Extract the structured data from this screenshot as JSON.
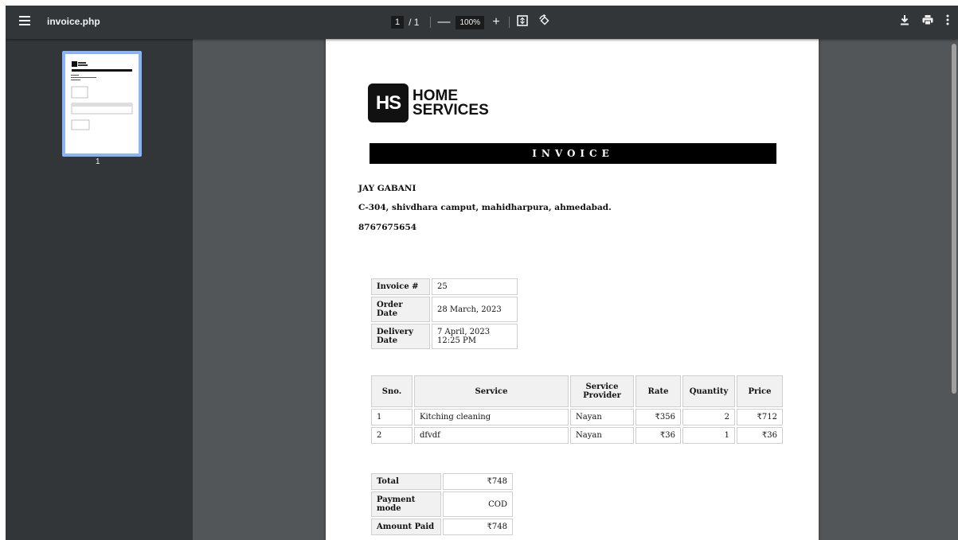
{
  "toolbar": {
    "title": "invoice.php",
    "page_current": "1",
    "page_total": "/ 1",
    "zoom": "100%",
    "zoom_out": "—",
    "zoom_in": "+"
  },
  "sidebar": {
    "thumb_label": "1"
  },
  "invoice": {
    "logo_mark": "HS",
    "logo_line1": "HOME",
    "logo_line2": "SERVICES",
    "heading": "INVOICE",
    "customer": {
      "name": "JAY GABANI",
      "address": "C-304, shivdhara camput, mahidharpura, ahmedabad.",
      "phone": "8767675654"
    },
    "meta": {
      "invoice_label": "Invoice #",
      "invoice_value": "25",
      "order_label": "Order Date",
      "order_value": "28 March, 2023",
      "delivery_label": "Delivery Date",
      "delivery_value": "7 April, 2023 12:25 PM"
    },
    "items_header": {
      "sno": "Sno.",
      "service": "Service",
      "provider": "Service Provider",
      "rate": "Rate",
      "quantity": "Quantity",
      "price": "Price"
    },
    "items": [
      {
        "sno": "1",
        "service": "Kitching cleaning",
        "provider": "Nayan",
        "rate": "₹356",
        "quantity": "2",
        "price": "₹712"
      },
      {
        "sno": "2",
        "service": "dfvdf",
        "provider": "Nayan",
        "rate": "₹36",
        "quantity": "1",
        "price": "₹36"
      }
    ],
    "totals": {
      "total_label": "Total",
      "total_value": "₹748",
      "mode_label": "Payment mode",
      "mode_value": "COD",
      "paid_label": "Amount Paid",
      "paid_value": "₹748"
    }
  }
}
